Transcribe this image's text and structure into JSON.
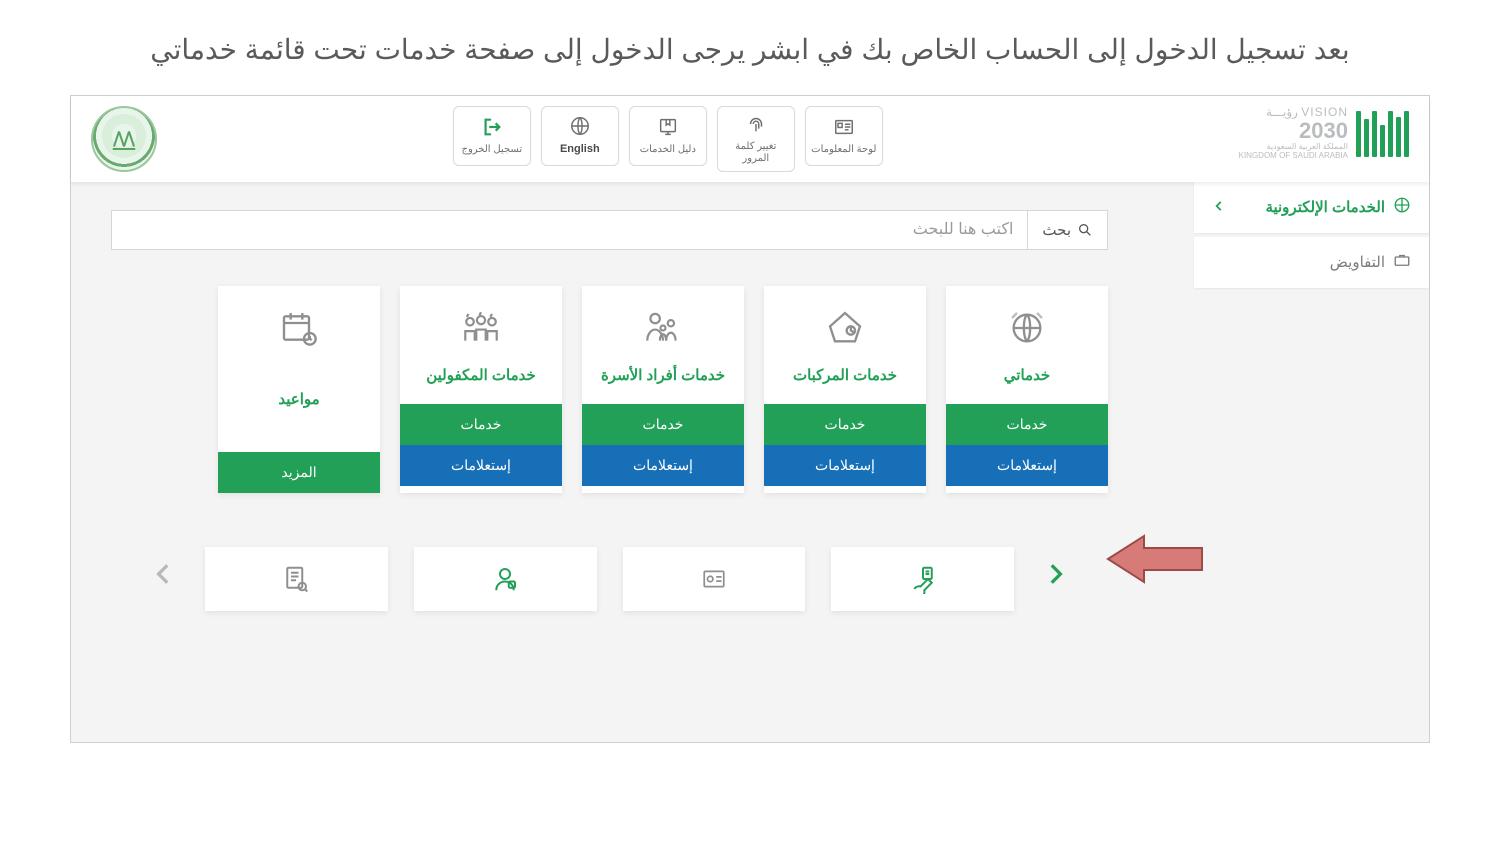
{
  "instruction": "بعد تسجيل الدخول إلى الحساب الخاص بك في ابشر يرجى الدخول إلى صفحة خدمات تحت قائمة خدماتي",
  "header": {
    "nav": {
      "logout": {
        "label": "تسجيل الخروج"
      },
      "english": {
        "label": "English"
      },
      "services_guide": {
        "label": "دليل الخدمات"
      },
      "change_password": {
        "label": "تغيير كلمة المرور"
      },
      "dashboard": {
        "label": "لوحة المعلومات"
      }
    },
    "logos": {
      "vision_line1": "رؤيـــة  VISION",
      "vision_line2": "2030",
      "vision_line3": "المملكة العربية السعودية",
      "vision_line4": "KINGDOM OF SAUDI ARABIA",
      "absher_text": "أبشر"
    }
  },
  "side": {
    "eservices": "الخدمات الإلكترونية",
    "authorizations": "التفاويض"
  },
  "search": {
    "button_label": "بحث",
    "placeholder": "اكتب هنا للبحث"
  },
  "tiles": [
    {
      "id": "my_services",
      "title": "خدماتي",
      "primary": "خدمات",
      "secondary": "إستعلامات"
    },
    {
      "id": "vehicles",
      "title": "خدمات المركبات",
      "primary": "خدمات",
      "secondary": "إستعلامات"
    },
    {
      "id": "family",
      "title": "خدمات أفراد الأسرة",
      "primary": "خدمات",
      "secondary": "إستعلامات"
    },
    {
      "id": "sponsored",
      "title": "خدمات المكفولين",
      "primary": "خدمات",
      "secondary": "إستعلامات"
    },
    {
      "id": "appointments",
      "title": "مواعيد",
      "primary": "المزيد",
      "secondary": null
    }
  ]
}
